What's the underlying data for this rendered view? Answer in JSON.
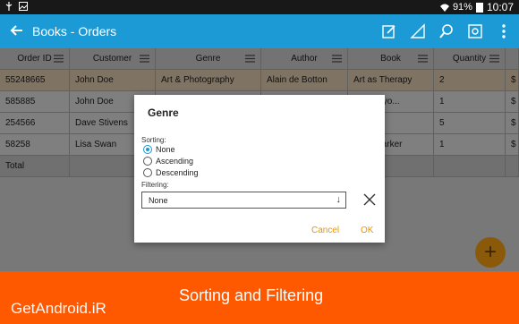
{
  "status_bar": {
    "battery": "91%",
    "time": "10:07"
  },
  "app_bar": {
    "title": "Books - Orders",
    "icons": [
      "back-arrow-icon",
      "edit-icon",
      "ruler-icon",
      "search-icon",
      "settings-icon",
      "more-icon"
    ]
  },
  "table": {
    "headers": [
      "Order ID",
      "Customer",
      "Genre",
      "Author",
      "Book",
      "Quantity",
      ""
    ],
    "rows": [
      [
        "55248665",
        "John Doe",
        "Art & Photography",
        "Alain de Botton",
        "Art as Therapy",
        "2",
        "$"
      ],
      [
        "585885",
        "John Doe",
        "",
        "",
        "the Crayo...",
        "1",
        "$"
      ],
      [
        "254566",
        "Dave Stivens",
        "",
        "",
        "rest",
        "5",
        "$"
      ],
      [
        "58258",
        "Lisa Swan",
        "",
        "",
        "ades Darker",
        "1",
        "$"
      ]
    ],
    "total_label": "Total"
  },
  "dialog": {
    "title": "Genre",
    "sorting_label": "Sorting:",
    "options": [
      "None",
      "Ascending",
      "Descending"
    ],
    "selected": "None",
    "filtering_label": "Filtering:",
    "filter_value": "None",
    "cancel": "Cancel",
    "ok": "OK"
  },
  "fab": {
    "label": "+"
  },
  "banner": {
    "brand": "GetAndroid.iR",
    "caption": "Sorting and Filtering"
  },
  "colors": {
    "app_bar": "#1b9ad6",
    "accent": "#e89400",
    "banner": "#fe5800",
    "selected_row": "#f3dcc0"
  }
}
